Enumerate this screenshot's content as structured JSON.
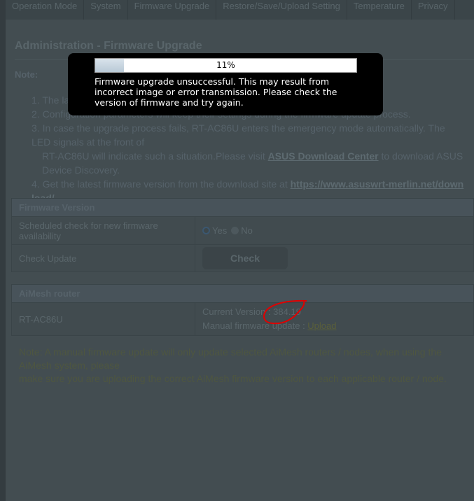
{
  "tabs": [
    "Operation Mode",
    "System",
    "Firmware Upgrade",
    "Restore/Save/Upload Setting",
    "Temperature",
    "Privacy"
  ],
  "page": {
    "title": "Administration - Firmware Upgrade",
    "note_label": "Note:",
    "notes": [
      "1. The latest firmware version is shown.",
      "2. Configuration parameters will keep their settings during the firmware update process.",
      "3. In case the upgrade process fails, RT-AC86U enters the emergency mode automatically. The LED signals at the front of",
      "RT-AC86U will indicate such a situation.Please visit ",
      "ASUS Download Center",
      " to download ASUS Device Discovery.",
      "4. Get the latest firmware version from the download site at ",
      "https://www.asuswrt-merlin.net/download/"
    ]
  },
  "firmware_version": {
    "header": "Firmware Version",
    "scheduled_label": "Scheduled check for new firmware availability",
    "yes": "Yes",
    "no": "No",
    "selected": "Yes",
    "check_label": "Check Update",
    "check_button": "Check"
  },
  "aimesh": {
    "header": "AiMesh router",
    "model": "RT-AC86U",
    "current_label": "Current Version : ",
    "current_version": "384.19",
    "manual_label": "Manual firmware update : ",
    "upload_link": "Upload"
  },
  "footnote": [
    "Note: A manual firmware update will only update selected AiMesh routers / nodes, when using the AiMesh system, please",
    "make sure you are uploading the correct AiMesh firmware version to each applicable router / node."
  ],
  "popup": {
    "progress_percent": 11,
    "progress_text": "11%",
    "message": "Firmware upgrade unsuccessful. This may result from incorrect image or error transmission. Please check the version of firmware and try again."
  },
  "colors": {
    "annotation": "#e00000",
    "overlay": "#000000"
  }
}
